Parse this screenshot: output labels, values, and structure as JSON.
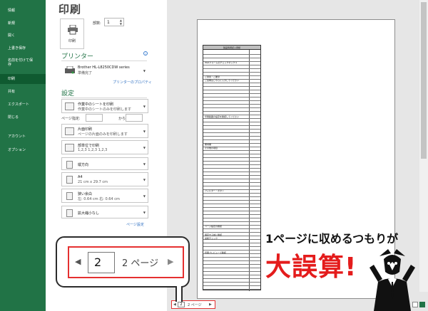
{
  "nav": {
    "items": [
      {
        "label": "情報"
      },
      {
        "label": "新規"
      },
      {
        "label": "開く"
      },
      {
        "label": "上書き保存"
      },
      {
        "label": "名前を付けて保存"
      },
      {
        "label": "印刷"
      },
      {
        "label": "共有"
      },
      {
        "label": "エクスポート"
      },
      {
        "label": "閉じる"
      },
      {
        "label": "アカウント"
      },
      {
        "label": "オプション"
      }
    ]
  },
  "print": {
    "title": "印刷",
    "print_button": "印刷",
    "copies_label": "部数:",
    "copies_value": "1"
  },
  "printer": {
    "heading": "プリンター",
    "info": "i",
    "name": "Brother HL-L8250CDW series",
    "status": "準備完了",
    "properties_link": "プリンターのプロパティ"
  },
  "settings": {
    "heading": "設定",
    "what": {
      "title": "作業中のシートを印刷",
      "sub": "作業中のシートのみを印刷します"
    },
    "pages_label": "ページ指定:",
    "to_label": "から",
    "sides": {
      "title": "片面印刷",
      "sub": "ページの片面のみを印刷します"
    },
    "collate": {
      "title": "部単位で印刷",
      "sub": "1,2,3    1,2,3    1,2,3"
    },
    "orientation": {
      "title": "縦方向"
    },
    "paper": {
      "title": "A4",
      "sub": "21 cm x 29.7 cm"
    },
    "margins": {
      "title": "狭い余白",
      "sub": "左:  0.64 cm    右:  0.64 cm"
    },
    "scaling": {
      "title": "拡大縮小なし"
    },
    "page_setup_link": "ページ設定"
  },
  "preview": {
    "table_title": "製品情報記入用紙",
    "rows": [
      {
        "text": "Webフォームのチェックボックス"
      },
      {
        "text": "ご意見・ご要望"
      },
      {
        "text": "ご質問はこちらに入力してください"
      },
      {
        "text": "印刷範囲の設定を確認してください"
      },
      {
        "text": "備考欄"
      },
      {
        "text": "その他の項目"
      },
      {
        "text": "フィルター・ボタン"
      },
      {
        "text": "ページ設定の確認"
      },
      {
        "text": "保存する前に確認"
      },
      {
        "text": "最終チェック"
      },
      {
        "text": "印刷プレビューで確認"
      }
    ]
  },
  "page_nav": {
    "current": "2",
    "total_label": "2 ページ",
    "prev_icon": "triangle-left",
    "next_icon": "triangle-right"
  },
  "callout": {
    "current": "2",
    "total_label": "2 ページ"
  },
  "annotation": {
    "line1": "1ページに収めるつもりが",
    "line2": "大誤算!"
  },
  "colors": {
    "excel_green": "#217346",
    "highlight_red": "#e53030",
    "annotation_red": "#e41c1c"
  }
}
